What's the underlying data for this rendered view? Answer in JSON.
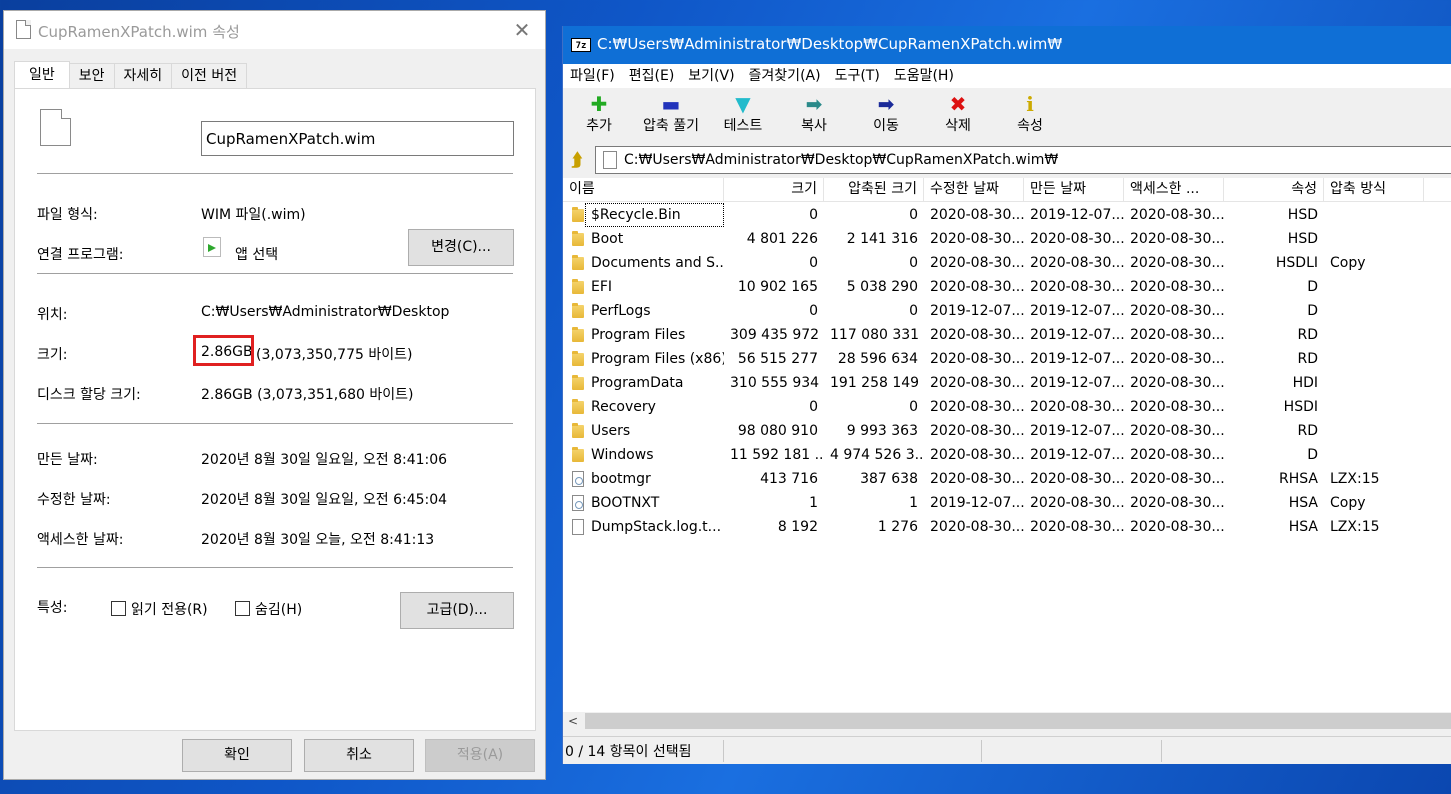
{
  "props_dialog": {
    "title": "CupRamenXPatch.wim 속성",
    "close_glyph": "✕",
    "tabs": [
      {
        "label": "일반"
      },
      {
        "label": "보안"
      },
      {
        "label": "자세히"
      },
      {
        "label": "이전 버전"
      }
    ],
    "file_name": "CupRamenXPatch.wim",
    "file_type_label": "파일 형식:",
    "file_type_value": "WIM 파일(.wim)",
    "opens_with_label": "연결 프로그램:",
    "opens_with_value": "앱 선택",
    "change_button": "변경(C)...",
    "location_label": "위치:",
    "location_value": "C:₩Users₩Administrator₩Desktop",
    "size_label": "크기:",
    "size_short": "2.86GB",
    "size_bytes": "(3,073,350,775 바이트)",
    "size_on_disk_label": "디스크 할당 크기:",
    "size_on_disk_value": "2.86GB (3,073,351,680 바이트)",
    "created_label": "만든 날짜:",
    "created_value": "2020년 8월 30일 일요일, 오전 8:41:06",
    "modified_label": "수정한 날짜:",
    "modified_value": "2020년 8월 30일 일요일, 오전 6:45:04",
    "accessed_label": "액세스한 날짜:",
    "accessed_value": "2020년 8월 30일 오늘, 오전 8:41:13",
    "attributes_label": "특성:",
    "readonly_label": "읽기 전용(R)",
    "hidden_label": "숨김(H)",
    "advanced_button": "고급(D)...",
    "ok_button": "확인",
    "cancel_button": "취소",
    "apply_button": "적용(A)"
  },
  "zip_window": {
    "logo_text": "7z",
    "title": "C:₩Users₩Administrator₩Desktop₩CupRamenXPatch.wim₩",
    "menu": [
      "파일(F)",
      "편집(E)",
      "보기(V)",
      "즐겨찾기(A)",
      "도구(T)",
      "도움말(H)"
    ],
    "toolbar": [
      {
        "label": "추가",
        "icon": "add-icon",
        "glyph": "✚",
        "color": "#22aa22"
      },
      {
        "label": "압축 풀기",
        "icon": "extract-icon",
        "glyph": "▬",
        "color": "#2233bb"
      },
      {
        "label": "테스트",
        "icon": "test-icon",
        "glyph": "▼",
        "color": "#22bbcc"
      },
      {
        "label": "복사",
        "icon": "copy-icon",
        "glyph": "➡",
        "color": "#2a8a8a"
      },
      {
        "label": "이동",
        "icon": "move-icon",
        "glyph": "➡",
        "color": "#1a2a99"
      },
      {
        "label": "삭제",
        "icon": "delete-icon",
        "glyph": "✖",
        "color": "#dd1111"
      },
      {
        "label": "속성",
        "icon": "info-icon",
        "glyph": "i",
        "color": "#ccaa00"
      }
    ],
    "up_glyph": "⮭",
    "address": "C:₩Users₩Administrator₩Desktop₩CupRamenXPatch.wim₩",
    "columns": [
      "이름",
      "크기",
      "압축된 크기",
      "수정한 날짜",
      "만든 날짜",
      "액세스한 ...",
      "속성",
      "압축 방식"
    ],
    "rows": [
      {
        "name": "$Recycle.Bin",
        "size": "0",
        "packed": "0",
        "modified": "2020-08-30...",
        "created": "2019-12-07...",
        "accessed": "2020-08-30...",
        "attr": "HSD",
        "method": "",
        "kind": "folder"
      },
      {
        "name": "Boot",
        "size": "4 801 226",
        "packed": "2 141 316",
        "modified": "2020-08-30...",
        "created": "2020-08-30...",
        "accessed": "2020-08-30...",
        "attr": "HSD",
        "method": "",
        "kind": "folder"
      },
      {
        "name": "Documents and S...",
        "size": "0",
        "packed": "0",
        "modified": "2020-08-30...",
        "created": "2020-08-30...",
        "accessed": "2020-08-30...",
        "attr": "HSDLI",
        "method": "Copy",
        "kind": "folder"
      },
      {
        "name": "EFI",
        "size": "10 902 165",
        "packed": "5 038 290",
        "modified": "2020-08-30...",
        "created": "2020-08-30...",
        "accessed": "2020-08-30...",
        "attr": "D",
        "method": "",
        "kind": "folder"
      },
      {
        "name": "PerfLogs",
        "size": "0",
        "packed": "0",
        "modified": "2019-12-07...",
        "created": "2019-12-07...",
        "accessed": "2020-08-30...",
        "attr": "D",
        "method": "",
        "kind": "folder"
      },
      {
        "name": "Program Files",
        "size": "309 435 972",
        "packed": "117 080 331",
        "modified": "2020-08-30...",
        "created": "2019-12-07...",
        "accessed": "2020-08-30...",
        "attr": "RD",
        "method": "",
        "kind": "folder"
      },
      {
        "name": "Program Files (x86)",
        "size": "56 515 277",
        "packed": "28 596 634",
        "modified": "2020-08-30...",
        "created": "2019-12-07...",
        "accessed": "2020-08-30...",
        "attr": "RD",
        "method": "",
        "kind": "folder"
      },
      {
        "name": "ProgramData",
        "size": "310 555 934",
        "packed": "191 258 149",
        "modified": "2020-08-30...",
        "created": "2019-12-07...",
        "accessed": "2020-08-30...",
        "attr": "HDI",
        "method": "",
        "kind": "folder"
      },
      {
        "name": "Recovery",
        "size": "0",
        "packed": "0",
        "modified": "2020-08-30...",
        "created": "2020-08-30...",
        "accessed": "2020-08-30...",
        "attr": "HSDI",
        "method": "",
        "kind": "folder"
      },
      {
        "name": "Users",
        "size": "98 080 910",
        "packed": "9 993 363",
        "modified": "2020-08-30...",
        "created": "2019-12-07...",
        "accessed": "2020-08-30...",
        "attr": "RD",
        "method": "",
        "kind": "folder"
      },
      {
        "name": "Windows",
        "size": "11 592 181 ...",
        "packed": "4 974 526 3...",
        "modified": "2020-08-30...",
        "created": "2019-12-07...",
        "accessed": "2020-08-30...",
        "attr": "D",
        "method": "",
        "kind": "folder"
      },
      {
        "name": "bootmgr",
        "size": "413 716",
        "packed": "387 638",
        "modified": "2020-08-30...",
        "created": "2020-08-30...",
        "accessed": "2020-08-30...",
        "attr": "RHSA",
        "method": "LZX:15",
        "kind": "system-file"
      },
      {
        "name": "BOOTNXT",
        "size": "1",
        "packed": "1",
        "modified": "2019-12-07...",
        "created": "2020-08-30...",
        "accessed": "2020-08-30...",
        "attr": "HSA",
        "method": "Copy",
        "kind": "system-file"
      },
      {
        "name": "DumpStack.log.t...",
        "size": "8 192",
        "packed": "1 276",
        "modified": "2020-08-30...",
        "created": "2020-08-30...",
        "accessed": "2020-08-30...",
        "attr": "HSA",
        "method": "LZX:15",
        "kind": "file"
      }
    ],
    "scroll_left_glyph": "<",
    "status": "0 / 14 항목이 선택됨"
  }
}
